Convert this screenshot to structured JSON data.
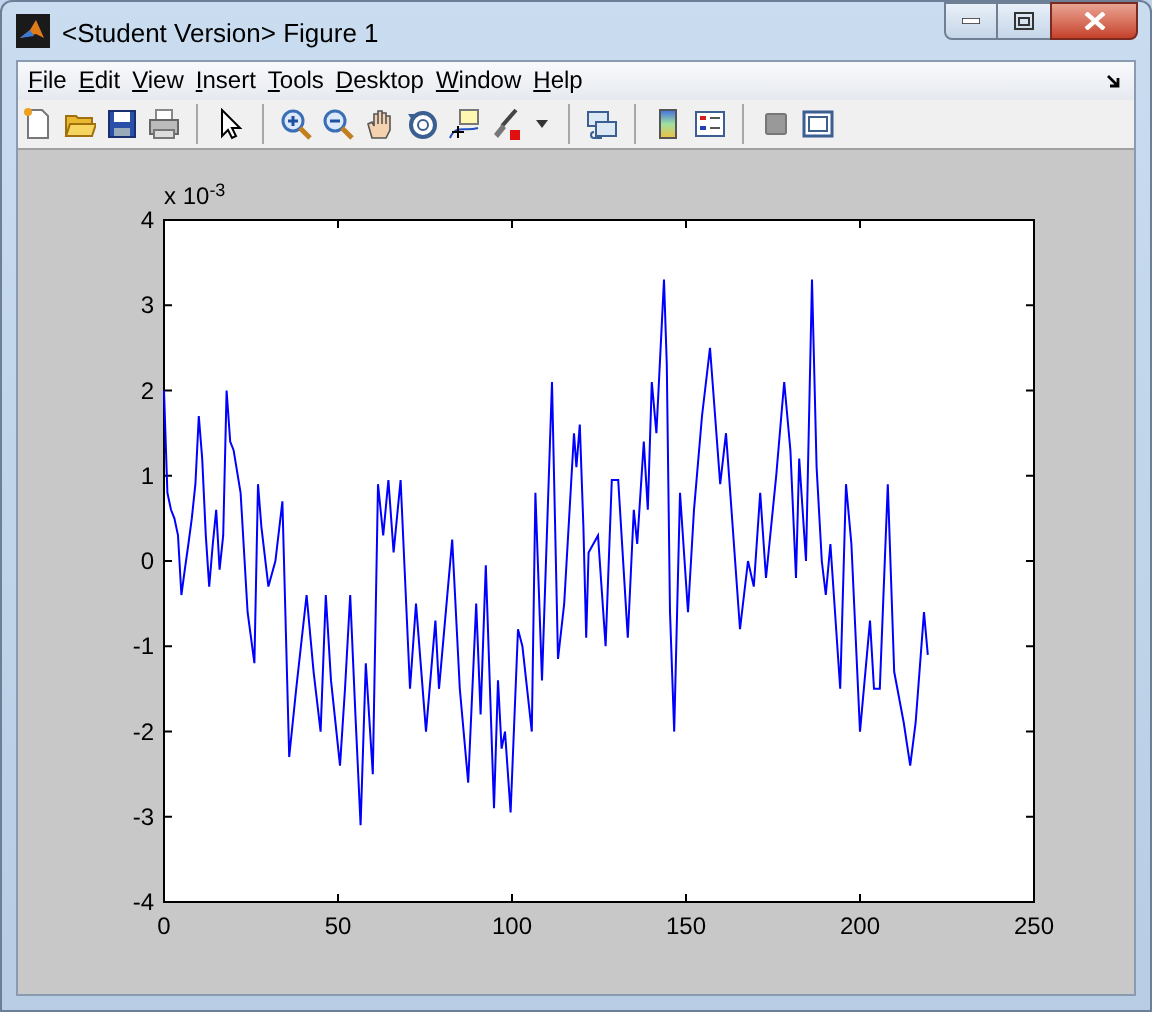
{
  "window": {
    "title": "<Student Version> Figure 1"
  },
  "menu": [
    {
      "label": "File"
    },
    {
      "label": "Edit"
    },
    {
      "label": "View"
    },
    {
      "label": "Insert"
    },
    {
      "label": "Tools"
    },
    {
      "label": "Desktop"
    },
    {
      "label": "Window"
    },
    {
      "label": "Help"
    }
  ],
  "figure": {
    "chart_data": {
      "type": "line",
      "annotations": [
        "x 10$^{-3}$"
      ],
      "xlim": [
        0,
        250
      ],
      "ylim": [
        -4,
        4
      ],
      "xticks": [
        0,
        50,
        100,
        150,
        200,
        250
      ],
      "yticks": [
        -4,
        -3,
        -2,
        -1,
        0,
        1,
        2,
        3,
        4
      ],
      "x": [
        0,
        1,
        2,
        3,
        4,
        5,
        6,
        7,
        8,
        9,
        10,
        11,
        12,
        13,
        14,
        15,
        16,
        17,
        18,
        19,
        20,
        22,
        24,
        26,
        27,
        28,
        30,
        32,
        34,
        36,
        38,
        41,
        43,
        45,
        46.5,
        48,
        50.6,
        52,
        53.5,
        55,
        56.5,
        58,
        60,
        61.5,
        63,
        64.5,
        66,
        68,
        70.7,
        72.4,
        75.3,
        78,
        79,
        81,
        82.8,
        85,
        87.4,
        89.7,
        91,
        92.5,
        94.8,
        96,
        97,
        98,
        99.6,
        101.7,
        103,
        105.7,
        106.7,
        108.6,
        111.5,
        113.2,
        115,
        117.8,
        118.5,
        119.5,
        120.5,
        121.3,
        122,
        124.7,
        126.9,
        128.7,
        130.5,
        133.3,
        135,
        136,
        137.9,
        139,
        140.2,
        141.5,
        143.7,
        144.5,
        145.4,
        146.6,
        148.3,
        150.6,
        152.3,
        154.6,
        156.9,
        159.8,
        161.5,
        165.5,
        167.8,
        169.5,
        171.3,
        173,
        175.9,
        178.2,
        180,
        181.6,
        182.5,
        184.5,
        186.2,
        187.5,
        189,
        190.2,
        191.5,
        194.3,
        196,
        197.5,
        200,
        202.9,
        204,
        205.7,
        208,
        209.8,
        212.6,
        214.4,
        216,
        218.4,
        219.5
      ],
      "series": [
        {
          "color": "#0000ff",
          "values": [
            2.0,
            0.8,
            0.6,
            0.5,
            0.3,
            -0.4,
            -0.1,
            0.2,
            0.5,
            0.9,
            1.7,
            1.2,
            0.3,
            -0.3,
            0.2,
            0.6,
            -0.1,
            0.3,
            2.0,
            1.4,
            1.3,
            0.8,
            -0.6,
            -1.2,
            0.9,
            0.4,
            -0.3,
            0.0,
            0.7,
            -2.3,
            -1.5,
            -0.4,
            -1.3,
            -2.0,
            -0.4,
            -1.4,
            -2.4,
            -1.5,
            -0.4,
            -1.8,
            -3.1,
            -1.2,
            -2.5,
            0.9,
            0.3,
            0.95,
            0.1,
            0.95,
            -1.5,
            -0.5,
            -2.0,
            -0.7,
            -1.5,
            -0.6,
            0.25,
            -1.5,
            -2.6,
            -0.5,
            -1.8,
            -0.05,
            -2.9,
            -1.4,
            -2.2,
            -2.0,
            -2.95,
            -0.8,
            -1.0,
            -2.0,
            0.8,
            -1.4,
            2.1,
            -1.15,
            -0.5,
            1.5,
            1.1,
            1.6,
            0.4,
            -0.9,
            0.1,
            0.3,
            -1.0,
            0.95,
            0.95,
            -0.9,
            0.6,
            0.2,
            1.4,
            0.6,
            2.1,
            1.5,
            3.3,
            2.3,
            -0.6,
            -2.0,
            0.8,
            -0.6,
            0.6,
            1.7,
            2.5,
            0.9,
            1.5,
            -0.8,
            0.0,
            -0.3,
            0.8,
            -0.2,
            1.0,
            2.1,
            1.3,
            -0.2,
            1.2,
            0.0,
            3.3,
            1.1,
            0.0,
            -0.4,
            0.2,
            -1.5,
            0.9,
            0.2,
            -2.0,
            -0.7,
            -1.5,
            -1.5,
            0.9,
            -1.3,
            -1.9,
            -2.4,
            -1.9,
            -0.6,
            -1.1
          ]
        }
      ]
    }
  }
}
